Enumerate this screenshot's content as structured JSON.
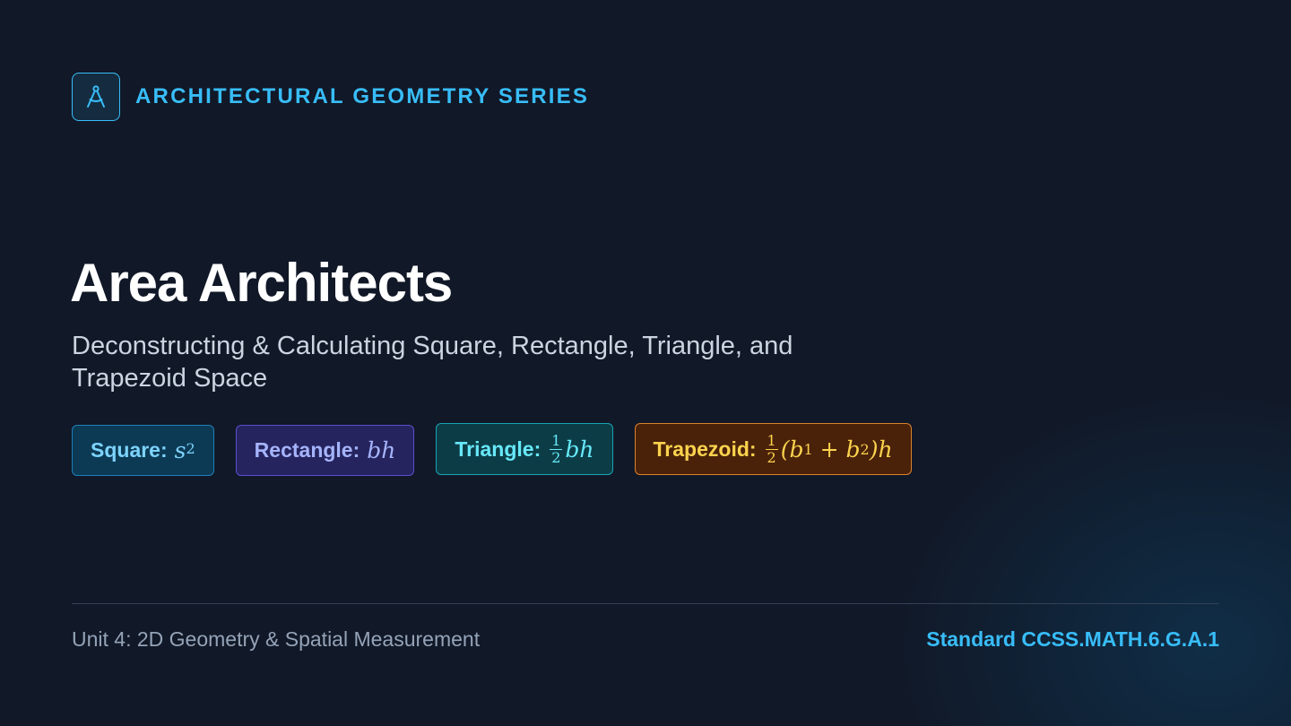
{
  "header": {
    "icon": "compass-icon",
    "series_title": "ARCHITECTURAL GEOMETRY SERIES"
  },
  "main": {
    "title": "Area Architects",
    "subtitle": "Deconstructing & Calculating Square, Rectangle, Triangle, and Trapezoid Space"
  },
  "formulas": {
    "square": {
      "label": "Square:",
      "var": "s",
      "exp": "2"
    },
    "rectangle": {
      "label": "Rectangle:",
      "expr": "bh"
    },
    "triangle": {
      "label": "Triangle:",
      "num": "1",
      "den": "2",
      "expr": "bh"
    },
    "trapezoid": {
      "label": "Trapezoid:",
      "num": "1",
      "den": "2",
      "open": "(b",
      "sub1": "1",
      "plus": " + b",
      "sub2": "2",
      "close": ")h"
    }
  },
  "footer": {
    "unit": "Unit 4: 2D Geometry & Spatial Measurement",
    "standard": "Standard CCSS.MATH.6.G.A.1"
  },
  "colors": {
    "accent": "#38bdf8",
    "background": "#111827",
    "square": "#7dd3fc",
    "rectangle": "#a5b4fc",
    "triangle": "#67e8f9",
    "trapezoid": "#fcd34d"
  }
}
